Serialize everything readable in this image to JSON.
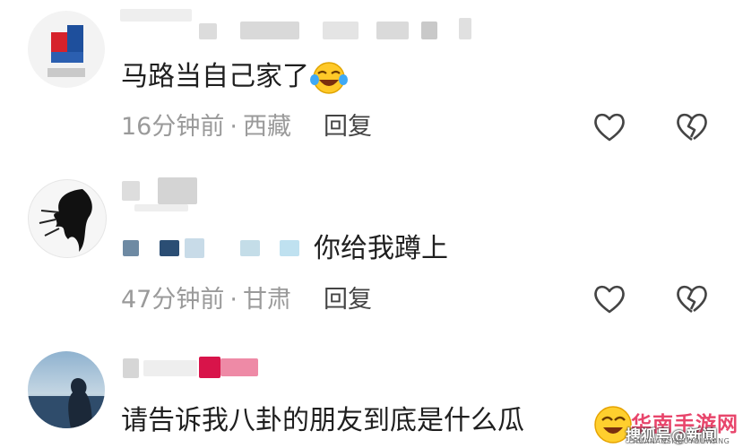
{
  "comments": [
    {
      "text": "马路当自己家了",
      "emoji": "laughing-crying-emoji",
      "time": "16分钟前",
      "separator": "·",
      "location": "西藏",
      "reply_label": "回复"
    },
    {
      "text": "你给我蹲上",
      "time": "47分钟前",
      "separator": "·",
      "location": "甘肃",
      "reply_label": "回复"
    },
    {
      "text": "请告诉我八卦的朋友到底是什么瓜",
      "emoji": "laughing-emoji"
    }
  ],
  "watermark": {
    "title": "华南手游网",
    "subtitle": "HUANANSHOUYOUWANG",
    "overlay": "搜狐号@新闻"
  },
  "icons": {
    "like": "heart-icon",
    "dislike": "broken-heart-icon"
  },
  "colors": {
    "meta": "#9a9a9a",
    "text": "#1f1f1f",
    "accent_pink": "#e8456b"
  }
}
